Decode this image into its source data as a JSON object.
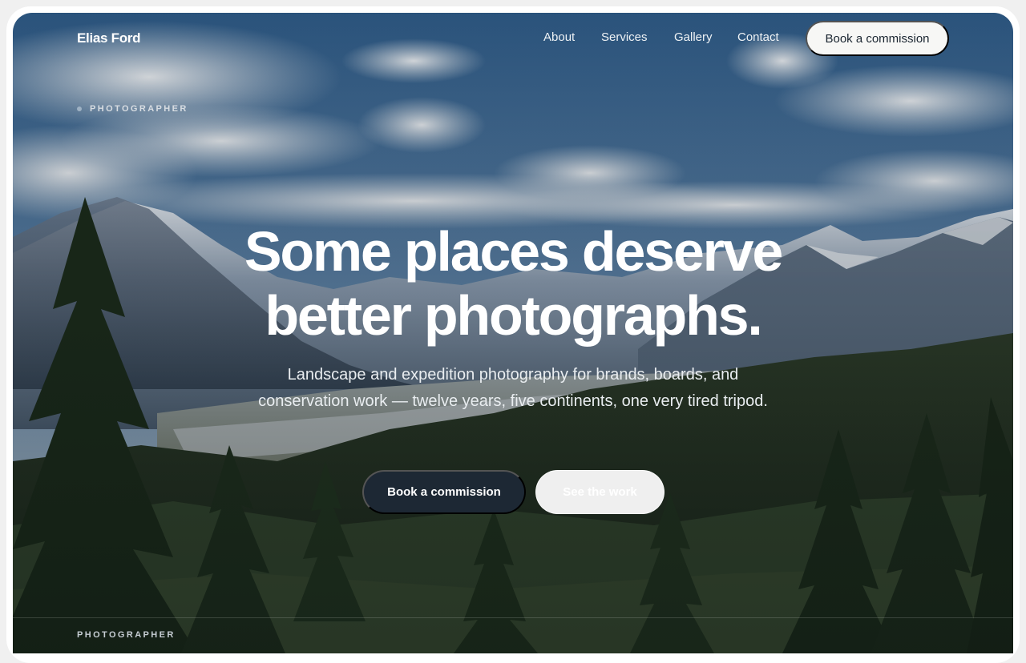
{
  "brand": {
    "name": "Elias Ford"
  },
  "nav": {
    "items": [
      {
        "label": "About"
      },
      {
        "label": "Services"
      },
      {
        "label": "Gallery"
      },
      {
        "label": "Contact"
      }
    ],
    "cta_label": "Book a commission"
  },
  "hero": {
    "eyebrow": "PHOTOGRAPHER",
    "headline_line1": "Some places deserve",
    "headline_line2": "better photographs.",
    "subtitle": "Landscape and expedition photography for brands, boards, and conservation work — twelve years, five continents, one very tired tripod.",
    "primary_button": "Book a commission",
    "secondary_button": "See the work"
  },
  "footer_strip": {
    "eyebrow": "PHOTOGRAPHER"
  },
  "colors": {
    "accent_dark": "#1d2834",
    "light_button": "#f7f7f5",
    "eyebrow_dot": "#9fb2c4"
  }
}
